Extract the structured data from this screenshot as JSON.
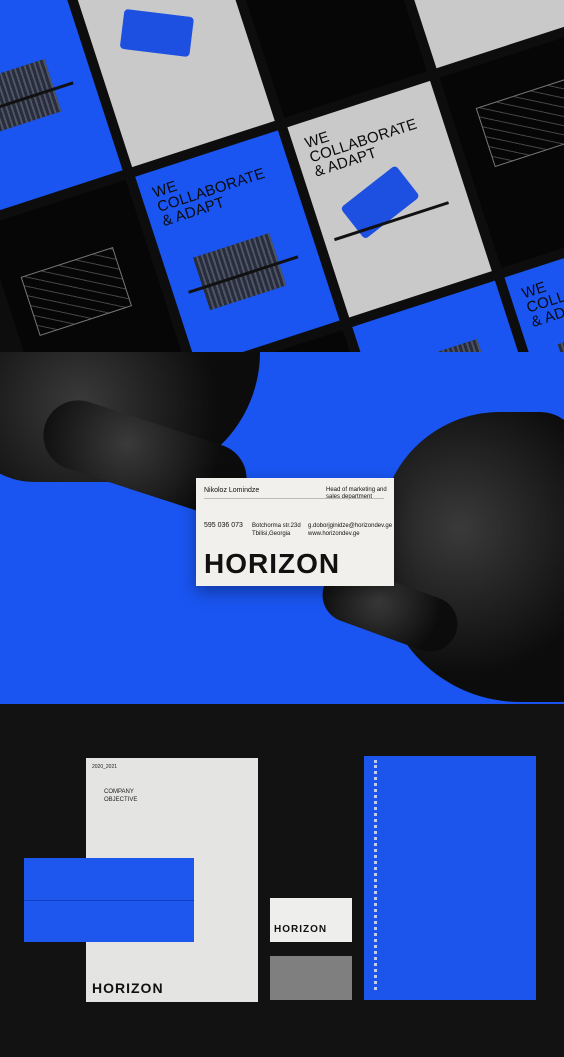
{
  "posters": {
    "headline_we": "WE",
    "headline_main": "COLLABORATE & ADAPT",
    "headline_line1": "COLLABORATE",
    "headline_line2": "& ADAPT"
  },
  "business_card": {
    "name": "Nikoloz Lomindze",
    "role": "Head of marketing and sales department",
    "phone": "595 036 073",
    "address_line1": "Botchorma str.23d",
    "address_line2": "Tbilisi,Georgia",
    "email": "g.doborjginidze@horizondev.ge",
    "website": "www.horizondev.ge",
    "brand": "HORIZON"
  },
  "letterhead": {
    "year": "2020_2021",
    "heading_line1": "COMPANY",
    "heading_line2": "OBJECTIVE",
    "brand": "HORIZON"
  },
  "small_card": {
    "brand": "HORIZON"
  },
  "colors": {
    "brand_blue": "#1a55f2",
    "dark": "#0d0d0d",
    "paper": "#e4e4e2",
    "gray": "#c9c9c9"
  }
}
